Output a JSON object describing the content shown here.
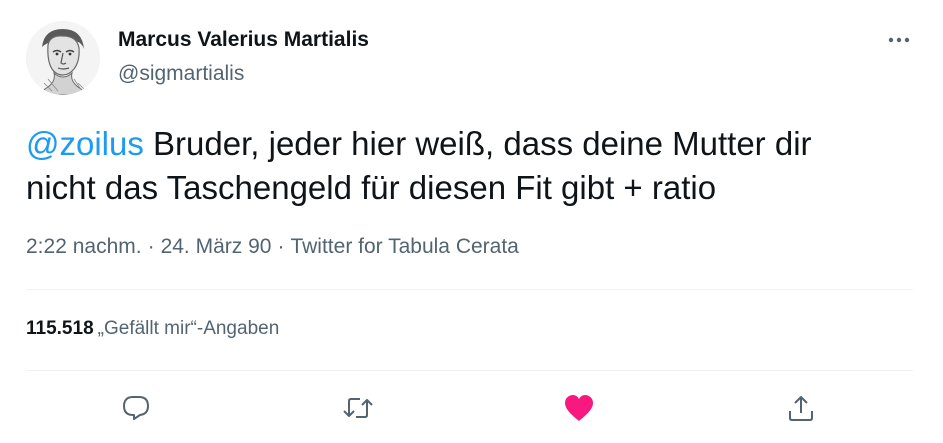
{
  "author": {
    "display_name": "Marcus Valerius Martialis",
    "handle": "@sigmartialis",
    "avatar_icon": "bust-avatar-icon"
  },
  "tweet": {
    "mention": "@zoilus",
    "text_line1": " Bruder, jeder hier weiß, dass deine Mutter dir",
    "text_line2": "nicht das Taschengeld für diesen Fit gibt + ratio"
  },
  "meta": {
    "time": "2:22 nachm.",
    "separator": "·",
    "date": "24. März 90",
    "source": "Twitter for Tabula Cerata"
  },
  "stats": {
    "likes_count": "115.518",
    "likes_label": "„Gefällt mir“-Angaben"
  },
  "actions": {
    "reply_icon": "reply-icon",
    "retweet_icon": "retweet-icon",
    "like_icon": "heart-icon",
    "share_icon": "share-icon",
    "more_icon": "more-options-icon"
  },
  "colors": {
    "accent": "#1d9bf0",
    "like": "#f91880",
    "secondary_text": "#536471",
    "primary_text": "#0f1419",
    "divider": "#eff3f4"
  }
}
